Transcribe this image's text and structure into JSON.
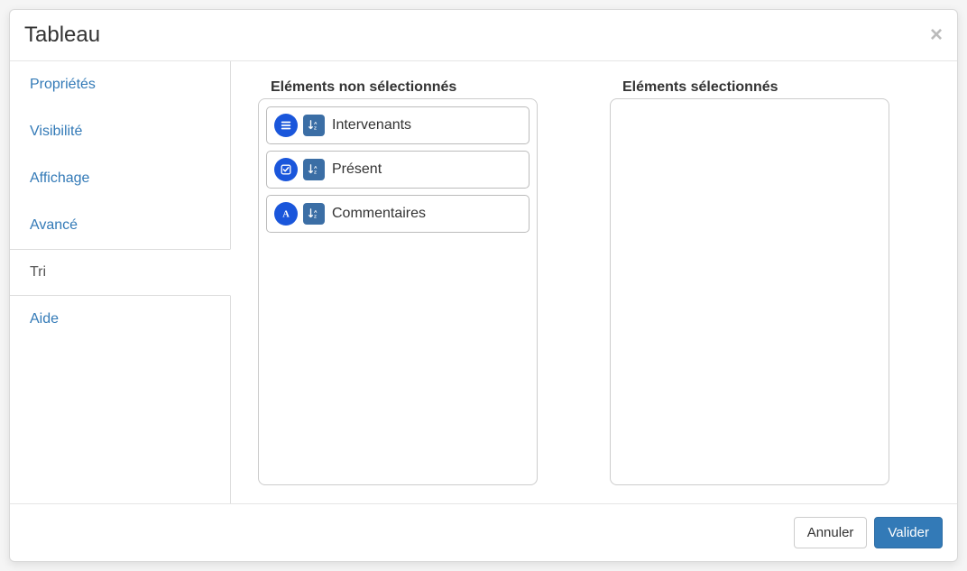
{
  "modal": {
    "title": "Tableau"
  },
  "sidebar": {
    "tabs": [
      {
        "label": "Propriétés",
        "active": false
      },
      {
        "label": "Visibilité",
        "active": false
      },
      {
        "label": "Affichage",
        "active": false
      },
      {
        "label": "Avancé",
        "active": false
      },
      {
        "label": "Tri",
        "active": true
      },
      {
        "label": "Aide",
        "active": false
      }
    ]
  },
  "columns": {
    "unselected": {
      "title": "Eléments non sélectionnés",
      "items": [
        {
          "label": "Intervenants",
          "type": "list"
        },
        {
          "label": "Présent",
          "type": "checkbox"
        },
        {
          "label": "Commentaires",
          "type": "text"
        }
      ]
    },
    "selected": {
      "title": "Eléments sélectionnés",
      "items": []
    }
  },
  "footer": {
    "cancel": "Annuler",
    "validate": "Valider"
  }
}
